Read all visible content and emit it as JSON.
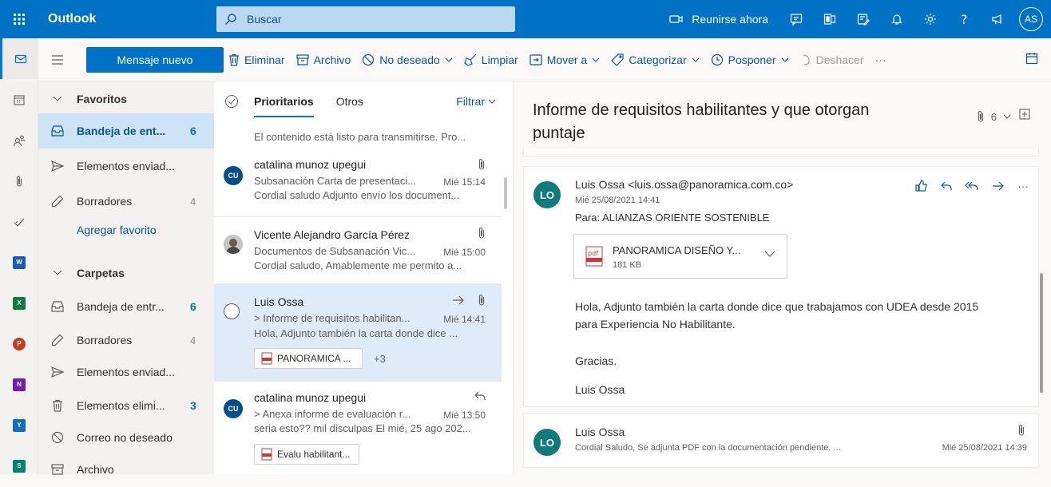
{
  "topbar": {
    "app_name": "Outlook",
    "search_placeholder": "Buscar",
    "meet_now": "Reunirse ahora",
    "avatar_initials": "AS"
  },
  "command_bar": {
    "new_message": "Mensaje nuevo",
    "delete": "Eliminar",
    "archive": "Archivo",
    "junk": "No deseado",
    "sweep": "Limpiar",
    "move_to": "Mover a",
    "categorize": "Categorizar",
    "snooze": "Posponer",
    "undo": "Deshacer",
    "more": "···"
  },
  "folders": {
    "favorites_header": "Favoritos",
    "favorites": [
      {
        "label": "Bandeja de ent...",
        "count": "6",
        "icon": "inbox-icon"
      },
      {
        "label": "Elementos enviad...",
        "count": "",
        "icon": "send-icon"
      },
      {
        "label": "Borradores",
        "count": "4",
        "icon": "pencil-icon"
      }
    ],
    "add_favorite": "Agregar favorito",
    "folders_header": "Carpetas",
    "folders": [
      {
        "label": "Bandeja de entr...",
        "count": "6",
        "icon": "inbox-icon"
      },
      {
        "label": "Borradores",
        "count": "4",
        "icon": "pencil-icon"
      },
      {
        "label": "Elementos enviad...",
        "count": "",
        "icon": "send-icon"
      },
      {
        "label": "Elementos elimi...",
        "count": "3",
        "icon": "trash-icon"
      },
      {
        "label": "Correo no deseado",
        "count": "",
        "icon": "block-icon"
      },
      {
        "label": "Archivo",
        "count": "",
        "icon": "archive-icon"
      }
    ]
  },
  "message_list": {
    "tab_focused": "Prioritarios",
    "tab_other": "Otros",
    "filter": "Filtrar",
    "previous_preview": "El contenido está listo para transmitirse. Pro...",
    "messages": [
      {
        "initials": "CU",
        "sender": "catalina munoz upegui",
        "subject": "Subsanación Carta de presentaci...",
        "time": "Mié 15:14",
        "preview": "Cordial saludo Adjunto envío los document..."
      },
      {
        "initials": "",
        "sender": "Vicente Alejandro García Pérez",
        "subject": "Documentos de Subsanación Vic...",
        "time": "Mié 15:00",
        "preview": "Cordial saludo, Amablemente me permito a..."
      },
      {
        "initials": "",
        "sender": "Luis Ossa",
        "subject": "> Informe de requisitos habilitan...",
        "time": "Mié 14:41",
        "preview": "Hola, Adjunto también la carta donde dice ...",
        "attachment": "PANORAMICA ...",
        "more": "+3"
      },
      {
        "initials": "CU",
        "sender": "catalina munoz upegui",
        "subject": "> Anexa informe de evaluación r...",
        "time": "Mié 13:50",
        "preview": "seria esto?? mil disculpas El mié, 25 ago 202...",
        "attachment": "Evalu habilitant..."
      }
    ]
  },
  "reading": {
    "subject": "Informe de requisitos habilitantes y que otorgan puntaje",
    "thread_count": "6",
    "message": {
      "initials": "LO",
      "from": "Luis Ossa <luis.ossa@panoramica.com.co>",
      "date": "Mié 25/08/2021 14:41",
      "to": "Para:  ALIANZAS ORIENTE SOSTENIBLE",
      "attachment_name": "PANORAMICA DISEÑO Y...",
      "attachment_size": "181 KB",
      "body": [
        "Hola, Adjunto también la carta donde dice que trabajamos con UDEA desde 2015 para Experiencia No Habilitante.",
        "Gracias.",
        "Luis Ossa"
      ]
    },
    "collapsed": {
      "initials": "LO",
      "from": "Luis Ossa",
      "preview": "Cordial Saludo, Se adjunta PDF con la documentación pendiente. ...",
      "date": "Mié 25/08/2021 14:39"
    }
  },
  "colors": {
    "brand": "#0072c6",
    "selected_folder": "#cce4f6",
    "selected_message": "#deecf9",
    "avatar_lo": "#0f7b7a",
    "avatar_cu": "#004e8c"
  }
}
